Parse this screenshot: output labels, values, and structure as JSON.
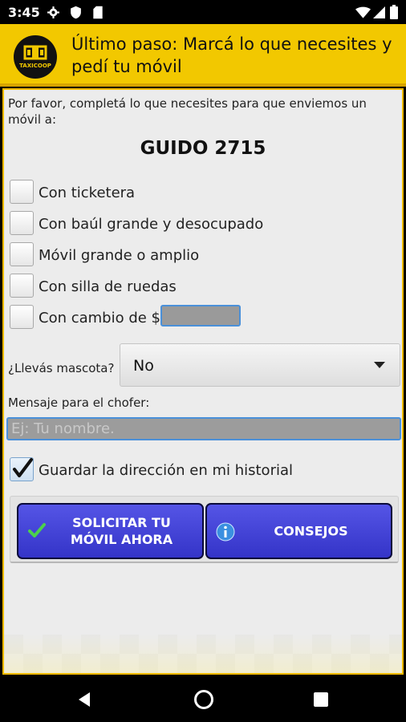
{
  "status_bar": {
    "time": "3:45"
  },
  "header": {
    "title": "Último paso: Marcá lo que necesites y pedí tu móvil",
    "logo_text": "TAXICOOP",
    "background_color": "#f2c800"
  },
  "form": {
    "intro": "Por favor, completá lo que necesites para que enviemos un móvil a:",
    "address": "GUIDO 2715",
    "options": [
      {
        "label": "Con ticketera",
        "checked": false
      },
      {
        "label": "Con baúl grande y desocupado",
        "checked": false
      },
      {
        "label": "Móvil grande o amplio",
        "checked": false
      },
      {
        "label": "Con silla de ruedas",
        "checked": false
      },
      {
        "label": "Con cambio de $",
        "checked": false
      }
    ],
    "change_amount_value": "",
    "pet": {
      "label": "¿Llevás mascota?",
      "selected": "No"
    },
    "message": {
      "label": "Mensaje para el chofer:",
      "placeholder": "Ej: Tu nombre.",
      "value": ""
    },
    "save_history": {
      "label": "Guardar la dirección en mi historial",
      "checked": true
    }
  },
  "buttons": {
    "request_label": "SOLICITAR TU MÓVIL AHORA",
    "tips_label": "CONSEJOS",
    "color": "#3e3ed8"
  }
}
